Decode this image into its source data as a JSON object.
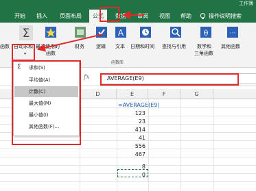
{
  "window": {
    "title": "工作簿"
  },
  "menubar": {
    "tabs": [
      "开始",
      "插入",
      "页面布局",
      "公式",
      "数据",
      "审阅",
      "视图",
      "帮助"
    ],
    "active_tab": "公式",
    "tell_me": "操作说明搜索"
  },
  "ribbon": {
    "left_cut_label": "函数",
    "autosum": {
      "label": "自动求和"
    },
    "recent": {
      "line1": "最近使用的",
      "line2": "函数"
    },
    "finance": {
      "label": "财务"
    },
    "logic": {
      "label": "逻辑"
    },
    "text": {
      "label": "文本"
    },
    "datetime": {
      "label": "日期和时间"
    },
    "lookup": {
      "label": "查找与引用"
    },
    "math": {
      "line1": "数学和",
      "line2": "三角函数"
    },
    "other": {
      "label": "其他函数"
    },
    "group_label": "函数库"
  },
  "formula_bar": {
    "fx": "fx",
    "value": "AVERAGE(E9)"
  },
  "columns": [
    "D",
    "E",
    "F",
    "G"
  ],
  "row_partial_label": "E",
  "cells": {
    "e_formula": "=AVERAGE(E9)",
    "values": [
      "123",
      "23",
      "414",
      "41",
      "556",
      "467",
      "8",
      "0"
    ]
  },
  "dropdown": {
    "items": [
      "求和(S)",
      "平均值(A)",
      "计数(C)",
      "最大值(M)",
      "最小值(I)",
      "其他函数(F)..."
    ],
    "highlighted_index": 2,
    "sigma": "Σ"
  },
  "colors": {
    "excel_green": "#217346",
    "annotation_red": "#e02a2a"
  }
}
